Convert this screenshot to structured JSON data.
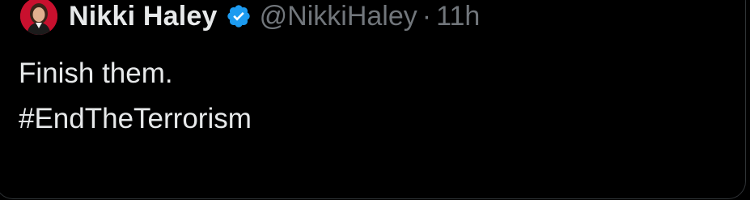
{
  "tweet": {
    "author": {
      "display_name": "Nikki Haley",
      "handle": "@NikkiHaley",
      "avatar_icon": "avatar-photo",
      "verified_icon": "verified-badge-icon"
    },
    "separator": "·",
    "timestamp": "11h",
    "text_lines": [
      "Finish them.",
      "#EndTheTerrorism"
    ]
  },
  "colors": {
    "background": "#000000",
    "primary_text": "#e7e9ea",
    "secondary_text": "#71767b",
    "verified_blue": "#1d9bf0",
    "border": "#2f3336",
    "avatar_red": "#c8102e"
  }
}
